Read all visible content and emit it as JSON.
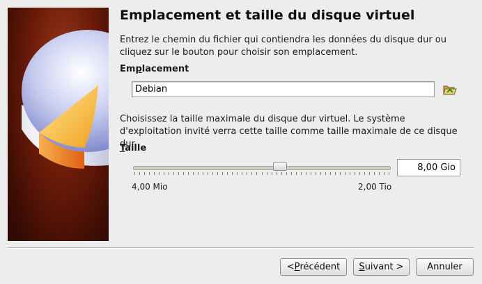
{
  "wizard": {
    "title": "Emplacement et taille du disque virtuel",
    "location_description": "Entrez le chemin du fichier qui contiendra les données du disque dur ou cliquez sur le bouton pour choisir son emplacement.",
    "location_label": {
      "before": "Em",
      "mnemonic": "p",
      "after": "lacement"
    },
    "location_value": "Debian",
    "size_description": "Choisissez la taille maximale du disque dur virtuel. Le système d'exploitation invité verra cette taille comme taille maximale de ce disque dur.",
    "size_label": {
      "mnemonic": "T",
      "after": "aille"
    },
    "size_value": "8,00 Gio",
    "slider": {
      "min_label": "4,00 Mio",
      "max_label": "2,00 Tio",
      "position_fraction": 0.57
    }
  },
  "buttons": {
    "prev": {
      "before": "< ",
      "mnemonic": "P",
      "after": "récédent"
    },
    "next": {
      "mnemonic": "S",
      "after": "uivant >"
    },
    "cancel": "Annuler"
  },
  "icons": {
    "folder": "folder-open-icon",
    "banner": "hard-disk-icon"
  }
}
